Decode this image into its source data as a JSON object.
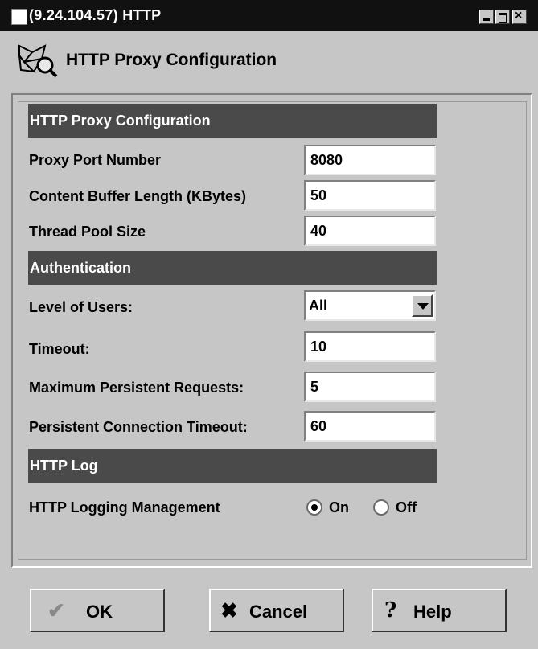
{
  "window": {
    "title": "(9.24.104.57) HTTP",
    "close_glyph": "×"
  },
  "header": {
    "title": "HTTP Proxy Configuration"
  },
  "sections": {
    "proxy": "HTTP Proxy Configuration",
    "auth": "Authentication",
    "log": "HTTP Log"
  },
  "fields": {
    "proxy_port": {
      "label": "Proxy Port Number",
      "value": "8080"
    },
    "buffer_length": {
      "label": "Content Buffer Length (KBytes)",
      "value": "50"
    },
    "thread_pool": {
      "label": "Thread Pool Size",
      "value": "40"
    },
    "level_of_users": {
      "label": "Level of Users:",
      "value": "All"
    },
    "timeout": {
      "label": "Timeout:",
      "value": "10"
    },
    "max_persistent": {
      "label": "Maximum Persistent Requests:",
      "value": "5"
    },
    "persistent_timeout": {
      "label": "Persistent Connection Timeout:",
      "value": "60"
    }
  },
  "logging": {
    "label": "HTTP Logging Management",
    "on_label": "On",
    "off_label": "Off",
    "selected": "On"
  },
  "buttons": {
    "ok": {
      "label": "OK",
      "icon": "✔"
    },
    "cancel": {
      "label": "Cancel",
      "icon": "✖"
    },
    "help": {
      "label": "Help",
      "icon": "?"
    }
  }
}
